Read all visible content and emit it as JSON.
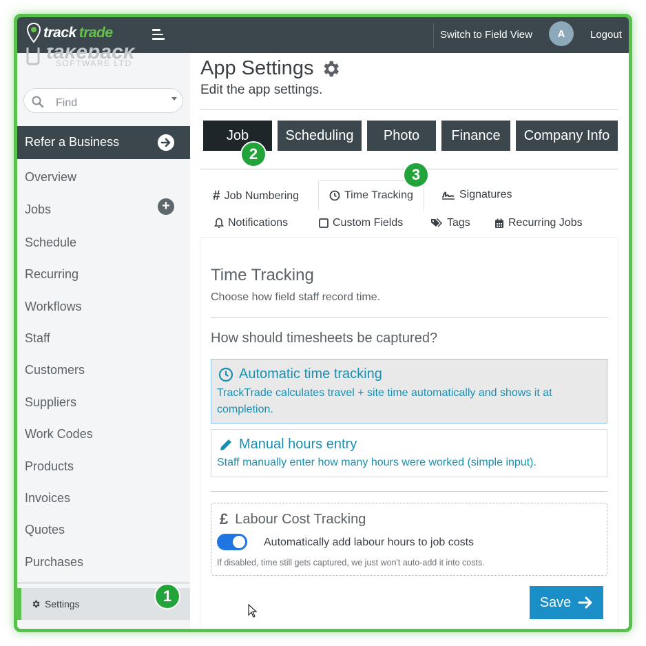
{
  "topbar": {
    "logo_part1": "track",
    "logo_part2": "trade",
    "switch_view": "Switch to Field View",
    "avatar_initial": "A",
    "logout": "Logout"
  },
  "sidebar": {
    "brand_ghost": "takeback",
    "brand_ghost_sub": "SOFTWARE LTD",
    "find_placeholder": "Find",
    "refer": "Refer a Business",
    "items": [
      "Overview",
      "Jobs",
      "Schedule",
      "Recurring",
      "Workflows",
      "Staff",
      "Customers",
      "Suppliers",
      "Work Codes",
      "Products",
      "Invoices",
      "Quotes",
      "Purchases"
    ],
    "settings": "Settings"
  },
  "badges": {
    "b1": "1",
    "b2": "2",
    "b3": "3"
  },
  "main": {
    "title": "App Settings",
    "subtitle": "Edit the app settings.",
    "tabs": [
      "Job",
      "Scheduling",
      "Photo",
      "Finance",
      "Company Info"
    ],
    "subtabs": {
      "job_numbering": "Job Numbering",
      "time_tracking": "Time Tracking",
      "signatures": "Signatures",
      "notifications": "Notifications",
      "custom_fields": "Custom Fields",
      "tags": "Tags",
      "recurring_jobs": "Recurring Jobs"
    },
    "section_title": "Time Tracking",
    "section_desc": "Choose how field staff record time.",
    "question": "How should timesheets be captured?",
    "option_auto_title": "Automatic time tracking",
    "option_auto_desc": "TrackTrade calculates travel + site time automatically and shows it at completion.",
    "option_manual_title": "Manual hours entry",
    "option_manual_desc": "Staff manually enter how many hours were worked (simple input).",
    "labour_symbol": "£",
    "labour_title": "Labour Cost Tracking",
    "labour_toggle_label": "Automatically add labour hours to job costs",
    "labour_toggle_on": true,
    "labour_hint": "If disabled, time still gets captured, we just won't auto-add it into costs.",
    "save": "Save"
  },
  "colors": {
    "accent_green": "#58c24c",
    "dark": "#3b474d",
    "link": "#1a8fb0",
    "save": "#1a8fc7",
    "toggle": "#1f76e0"
  }
}
